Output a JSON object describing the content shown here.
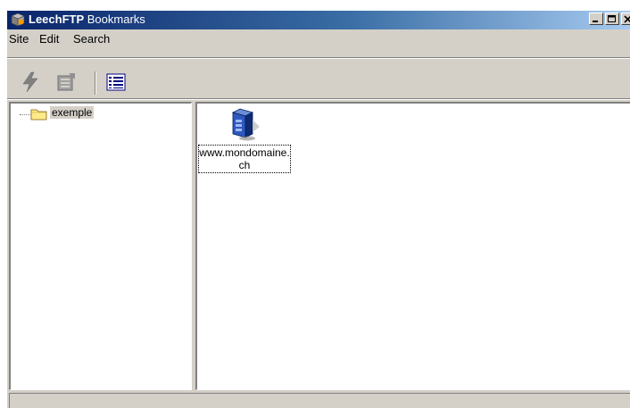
{
  "titlebar": {
    "app_name": "LeechFTP",
    "window_name": "Bookmarks",
    "controls": [
      "minimize-button",
      "maximize-button",
      "close-button"
    ]
  },
  "menubar": {
    "items": [
      {
        "label": "Site"
      },
      {
        "label": "Edit"
      },
      {
        "label": "Search"
      }
    ]
  },
  "toolbar": {
    "buttons": [
      "connect-icon",
      "site-properties-icon",
      "details-view-icon"
    ]
  },
  "tree": {
    "items": [
      {
        "label": "exemple",
        "icon": "folder-icon",
        "selected": true
      }
    ]
  },
  "list": {
    "items": [
      {
        "label": "www.mondomaine.ch",
        "icon": "server-icon"
      }
    ]
  },
  "statusbar": {
    "text": ""
  },
  "colors": {
    "titlebar_start": "#0a246a",
    "titlebar_end": "#a6caf0",
    "face": "#d4d0c8"
  }
}
